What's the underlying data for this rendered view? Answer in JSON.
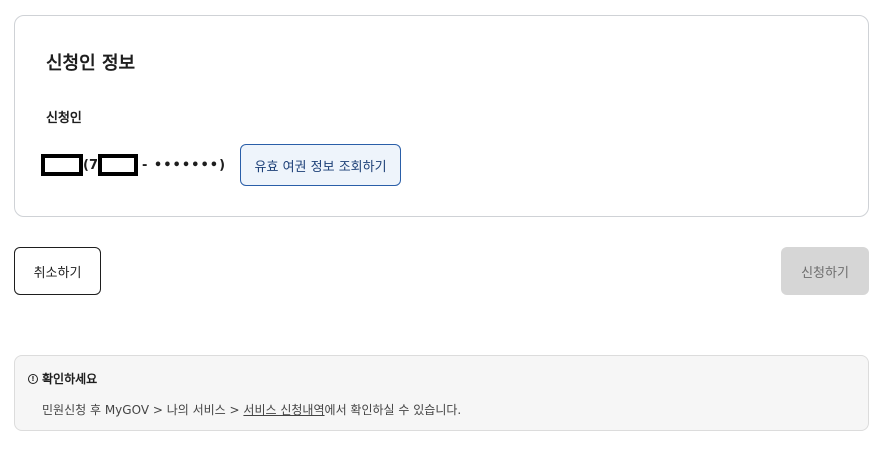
{
  "section": {
    "title": "신청인 정보",
    "applicant_label": "신청인",
    "id_open": "(7",
    "id_masked": "- •••••••)",
    "passport_button": "유효 여권 정보 조회하기"
  },
  "actions": {
    "cancel_label": "취소하기",
    "apply_label": "신청하기"
  },
  "notice": {
    "icon": "info-icon",
    "icon_glyph": "!",
    "title": "확인하세요",
    "text_before": "민원신청 후 MyGOV > 나의 서비스 > ",
    "link": "서비스 신청내역",
    "text_after": "에서 확인하실 수 있습니다."
  }
}
